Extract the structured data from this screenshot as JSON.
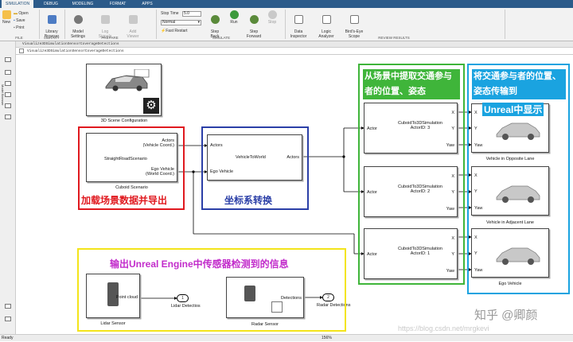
{
  "tabs": [
    "SIMULATION",
    "DEBUG",
    "MODELING",
    "FORMAT",
    "APPS"
  ],
  "ribbon": {
    "new": "New",
    "open": "Open",
    "save": "Save",
    "print": "Print",
    "library": "Library\nBrowser",
    "model_settings": "Model\nSettings",
    "log_signals": "Log\nSignals",
    "add_viewer": "Add\nViewer",
    "stop_time_label": "Stop Time",
    "stop_time": "5.0",
    "mode": "Normal",
    "fast_restart": "Fast Restart",
    "step_back": "Step\nBack",
    "run": "Run",
    "step_forward": "Step\nForward",
    "stop": "Stop",
    "data_inspector": "Data\nInspector",
    "logic_analyzer": "Logic\nAnalyzer",
    "birds_eye": "Bird's-Eye\nScope",
    "groups": {
      "file": "FILE",
      "library": "LIBRARY",
      "prepare": "PREPARE",
      "simulate": "SIMULATE",
      "review": "REVIEW RESULTS"
    }
  },
  "path": "Visualize3DSimulationSensorCoverageDetections",
  "address": "Visualize3DSimulationSensorCoverageDetections",
  "sidebar": {
    "browser_tab": "Model Browser"
  },
  "blocks": {
    "scene_config": {
      "caption": "3D Scene Configuration"
    },
    "cuboid": {
      "caption": "Cuboid Scenario",
      "out1": "Actors\n(Vehicle Coord.)",
      "out2": "Ego Vehicle\n(World Coord.)",
      "body": "StraightRoadScenario"
    },
    "v2w": {
      "in1": "Actors",
      "in2": "Ego Vehicle",
      "body": "VehicleToWorld",
      "out1": "Actors"
    },
    "c3d": [
      {
        "body": "CuboidTo3DSimulation\nActorID: 3",
        "in": "Actor",
        "outs": [
          "X",
          "Y",
          "Yaw"
        ]
      },
      {
        "body": "CuboidTo3DSimulation\nActorID: 2",
        "in": "Actor",
        "outs": [
          "X",
          "Y",
          "Yaw"
        ]
      },
      {
        "body": "CuboidTo3DSimulation\nActorID: 1",
        "in": "Actor",
        "outs": [
          "X",
          "Y",
          "Yaw"
        ]
      }
    ],
    "vehicles": [
      {
        "caption": "Vehicle in Opposite Lane",
        "ins": [
          "X",
          "Y",
          "Yaw"
        ]
      },
      {
        "caption": "Vehicle in Adjacent Lane",
        "ins": [
          "X",
          "Y",
          "Yaw"
        ]
      },
      {
        "caption": "Ego Vehicle",
        "ins": [
          "X",
          "Y",
          "Yaw"
        ]
      }
    ],
    "lidar": {
      "caption": "Lidar Sensor",
      "port": "Point cloud",
      "out_num": "1",
      "out_label": "Lidar Detectios"
    },
    "radar": {
      "caption": "Radar Sensor",
      "port": "Detections",
      "out_num": "2",
      "out_label": "Radar Detections"
    }
  },
  "annotations": {
    "red": "加载场景数据并导出",
    "blue": "坐标系转换",
    "green": "从场景中提取交通参与者的位置、姿态",
    "cyan_a": "将交通参与者的位置、姿态传输到",
    "cyan_b": "Unreal中显示",
    "yellow": "输出Unreal Engine中传感器检测到的信息"
  },
  "watermarks": {
    "zhihu": "知乎 @卿颜",
    "csdn": "https://blog.csdn.net/mrgkevi"
  },
  "status": {
    "left": "Ready",
    "zoom": "156%"
  },
  "colors": {
    "tabbar": "#2c5b8a",
    "red": "#e0191f",
    "blue": "#2b3fa7",
    "green": "#3fb53a",
    "cyan": "#1aa3e0",
    "yellow": "#f3e41a"
  }
}
